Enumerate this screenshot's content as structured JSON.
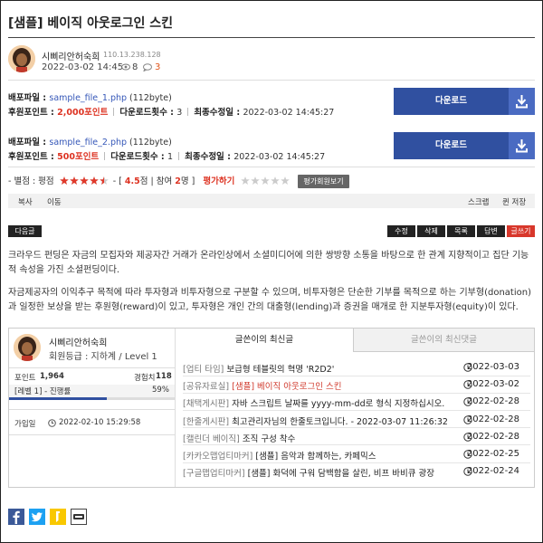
{
  "post": {
    "title": "[샘플] 베이직 아웃로그인 스킨",
    "author": "시삐리안허숙희",
    "ip": "110.13.238.128",
    "date": "2022-03-02 14:45",
    "views": "8",
    "comments": "3"
  },
  "files": [
    {
      "label": "배포파일 : ",
      "name": "sample_file_1.php",
      "size": " (112byte)",
      "points_label": "후원포인트 : ",
      "points": "2,000포인트",
      "downloads_label": "다운로드횟수 : ",
      "downloads": "3",
      "modified_label": "최종수정일 : ",
      "modified": "2022-03-02 14:45:27",
      "button": "다운로드"
    },
    {
      "label": "배포파일 : ",
      "name": "sample_file_2.php",
      "size": " (112byte)",
      "points_label": "후원포인트 : ",
      "points": "500포인트",
      "downloads_label": "다운로드횟수 : ",
      "downloads": "1",
      "modified_label": "최종수정일 : ",
      "modified": "2022-03-02 14:45:27",
      "button": "다운로드"
    }
  ],
  "rating": {
    "prefix": "- 별점 : 평점",
    "score_prefix": " - [ ",
    "score": "4.5",
    "score_suffix": "점 | 참여 ",
    "count": "2",
    "count_suffix": "명 ]",
    "rate_label": "평가하기",
    "rater_button": "평가회원보기",
    "stars": 4.5
  },
  "toolbar": {
    "copy": "복사",
    "move": "이동",
    "scrap": "스크랩",
    "save": "퀸 저장"
  },
  "actions": {
    "next": "다음글",
    "edit": "수정",
    "delete": "삭제",
    "list": "목록",
    "reply": "답변",
    "write": "글쓰기"
  },
  "content": {
    "p1": "크라우드 펀딩은 자금의 모집자와 제공자간 거래가 온라인상에서 소셜미디어에 의한 쌍방향 소통을 바탕으로 한 관계 지향적이고 집단 기능적 속성을 가진 소셜펀딩이다.",
    "p2": "자금제공자의 이익추구 목적에 따라 투자형과 비투자형으로 구분할 수 있으며, 비투자형은 단순한 기부를 목적으로 하는 기부형(donation)과 일정한 보상을 받는 후원형(reward)이 있고, 투자형은 개인 간의 대출형(lending)과 증권을 매개로 한 지분투자형(equity)이 있다."
  },
  "profile": {
    "name": "시삐리안허숙희",
    "level": "회원등급 : 지하계 / Level 1",
    "points_label": "포인트",
    "points": "1,964",
    "exp_label": "경험치",
    "exp": "118",
    "level_progress_label": "[레벨 1] - 진행률",
    "progress_percent": "59%",
    "progress": 0.59,
    "joined_label": "가입일",
    "joined": "2022-02-10 15:29:58"
  },
  "tabs": {
    "latest_posts": "글쓴이의 최신글",
    "latest_comments": "글쓴이의 최신댓글"
  },
  "latest": [
    {
      "category": "[업티 타임]",
      "title": " 보급형 테블릿의 혁명 'R2D2'",
      "date": "2022-03-03",
      "highlight": false
    },
    {
      "category": "[공유자료실]",
      "title": " [샘플] 베이직 아웃로그인 스킨",
      "date": "2022-03-02",
      "highlight": true
    },
    {
      "category": "[채택게시판]",
      "title": " 자바 스크립트 날짜를 yyyy-mm-dd로 형식 지정하십시오.",
      "date": "2022-02-28",
      "highlight": false
    },
    {
      "category": "[한줄게시판]",
      "title": " 최고관리자님의 한줄토크입니다. - 2022-03-07 11:26:32",
      "date": "2022-02-28",
      "highlight": false
    },
    {
      "category": "[캘린더 베이직]",
      "title": " 조직 구성 착수",
      "date": "2022-02-28",
      "highlight": false
    },
    {
      "category": "[카카오맵업티마커]",
      "title": " [샘플] 음악과 함께하는, 카페믹스",
      "date": "2022-02-25",
      "highlight": false
    },
    {
      "category": "[구글맵업티마커]",
      "title": " [샘플] 화덕에 구워 담백함을 살린, 비프 바비큐 광장",
      "date": "2022-02-24",
      "highlight": false
    }
  ],
  "colors": {
    "accent_blue": "#3050a0",
    "accent_red": "#d8372b",
    "comment_orange": "#e0541a"
  },
  "icons": {
    "share": [
      "facebook-icon",
      "twitter-icon",
      "kakaostory-icon",
      "band-icon"
    ]
  }
}
